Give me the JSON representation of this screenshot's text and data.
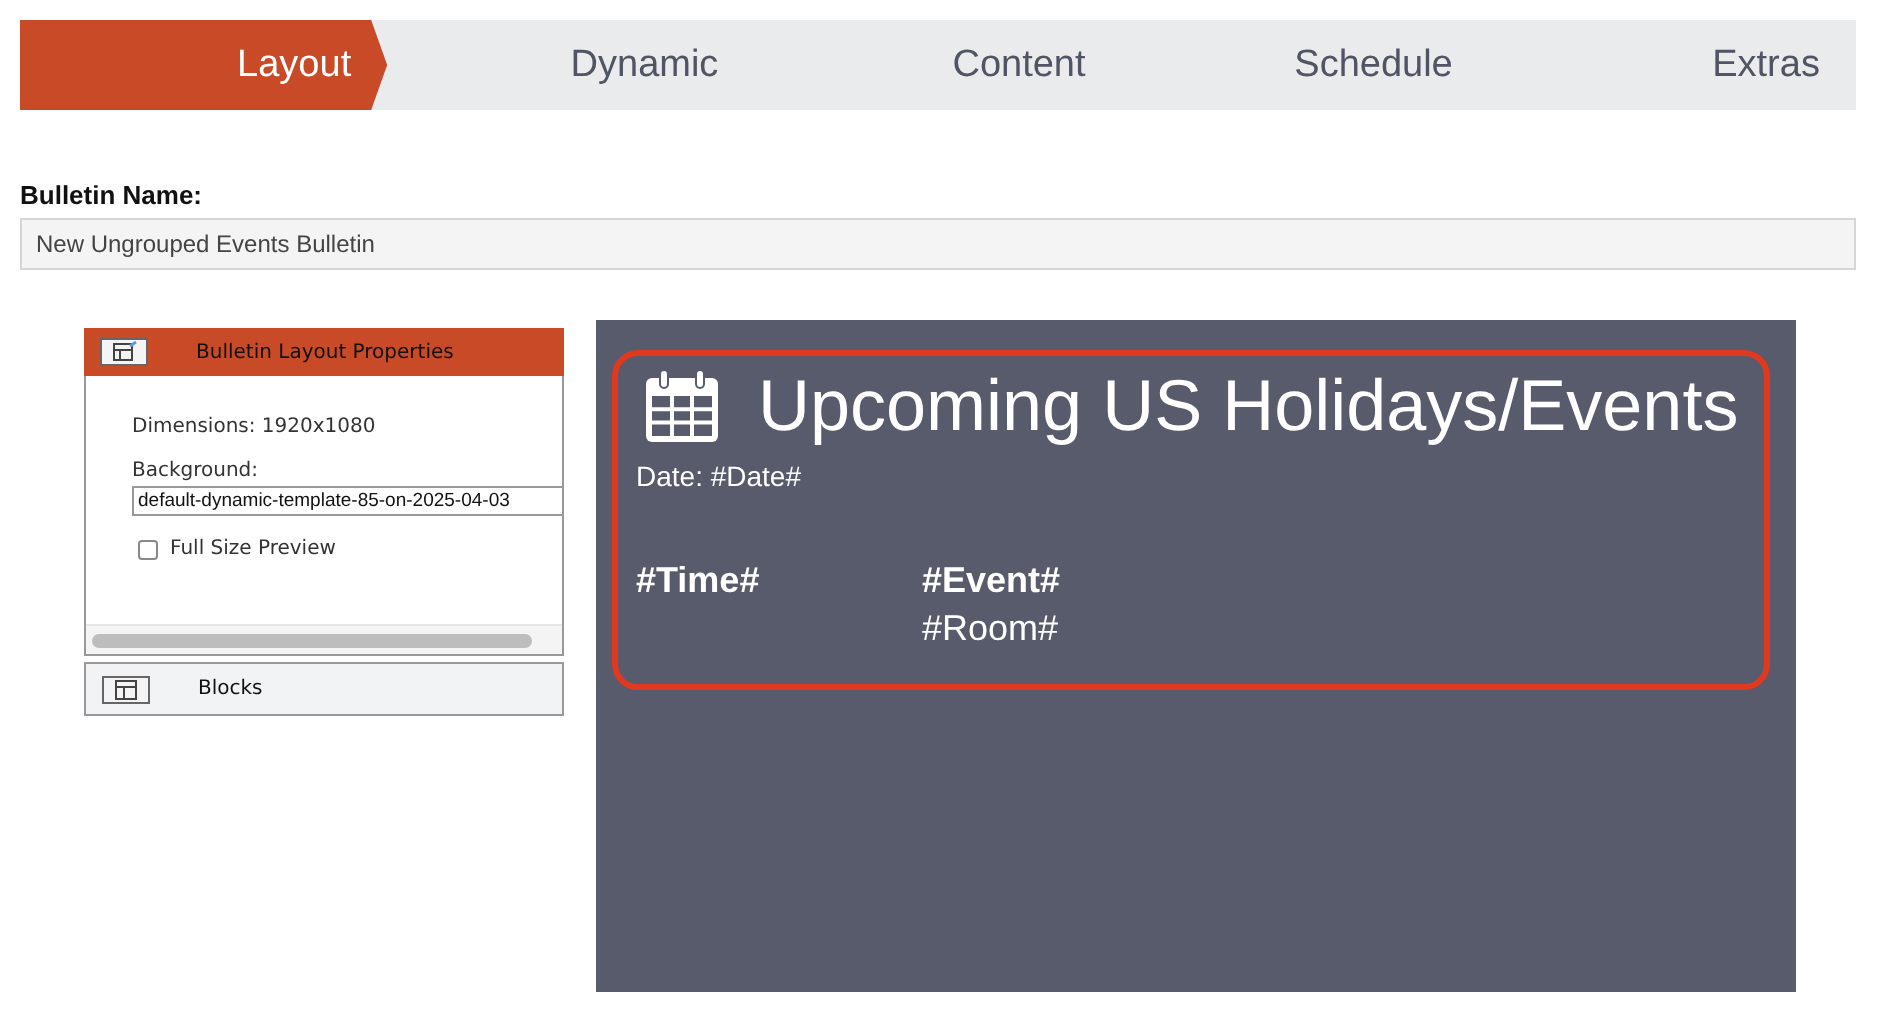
{
  "steps": [
    {
      "label": "Layout",
      "selected": true
    },
    {
      "label": "Dynamic",
      "selected": false
    },
    {
      "label": "Content",
      "selected": false
    },
    {
      "label": "Schedule",
      "selected": false
    },
    {
      "label": "Extras",
      "selected": false
    }
  ],
  "bulletin_name": {
    "label": "Bulletin Name:",
    "value": "New Ungrouped Events Bulletin"
  },
  "properties_panel": {
    "title": "Bulletin Layout Properties",
    "dimensions": "Dimensions: 1920x1080",
    "background_label": "Background:",
    "background_value": "default-dynamic-template-85-on-2025-04-03",
    "full_size_preview": {
      "label": "Full Size Preview",
      "checked": false
    }
  },
  "blocks_panel": {
    "title": "Blocks"
  },
  "preview": {
    "title": "Upcoming US Holidays/Events",
    "date": "Date: #Date#",
    "time": "#Time#",
    "event": "#Event#",
    "room": "#Room#"
  }
}
